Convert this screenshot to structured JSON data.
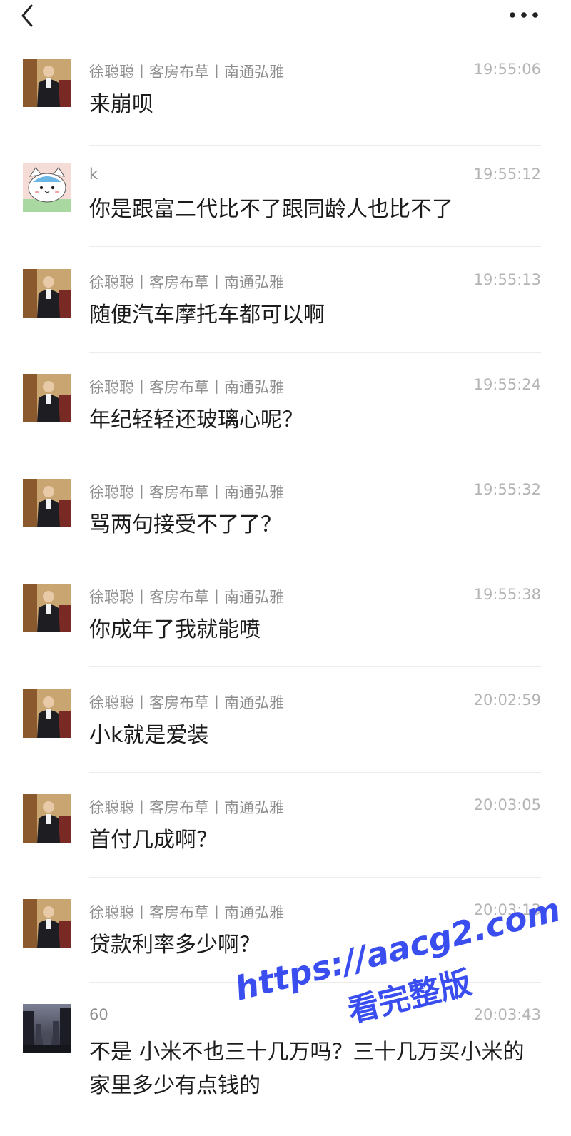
{
  "header": {
    "back_icon": "chevron-left-icon",
    "more_icon": "more-horizontal-icon"
  },
  "messages": [
    {
      "sender": "徐聪聪丨客房布草丨南通弘雅",
      "time": "19:55:06",
      "text": "来崩呗",
      "avatar": "man-in-suit-photo"
    },
    {
      "sender": "k",
      "time": "19:55:12",
      "text": "你是跟富二代比不了跟同龄人也比不了",
      "avatar": "cartoon-cat-avatar"
    },
    {
      "sender": "徐聪聪丨客房布草丨南通弘雅",
      "time": "19:55:13",
      "text": "随便汽车摩托车都可以啊",
      "avatar": "man-in-suit-photo"
    },
    {
      "sender": "徐聪聪丨客房布草丨南通弘雅",
      "time": "19:55:24",
      "text": "年纪轻轻还玻璃心呢？",
      "avatar": "man-in-suit-photo"
    },
    {
      "sender": "徐聪聪丨客房布草丨南通弘雅",
      "time": "19:55:32",
      "text": "骂两句接受不了了？",
      "avatar": "man-in-suit-photo"
    },
    {
      "sender": "徐聪聪丨客房布草丨南通弘雅",
      "time": "19:55:38",
      "text": "你成年了我就能喷",
      "avatar": "man-in-suit-photo"
    },
    {
      "sender": "徐聪聪丨客房布草丨南通弘雅",
      "time": "20:02:59",
      "text": "小k就是爱装",
      "avatar": "man-in-suit-photo"
    },
    {
      "sender": "徐聪聪丨客房布草丨南通弘雅",
      "time": "20:03:05",
      "text": "首付几成啊？",
      "avatar": "man-in-suit-photo"
    },
    {
      "sender": "徐聪聪丨客房布草丨南通弘雅",
      "time": "20:03:13",
      "text": "贷款利率多少啊？",
      "avatar": "man-in-suit-photo"
    },
    {
      "sender": "60",
      "time": "20:03:43",
      "text": "不是 小米不也三十几万吗？三十几万买小米的 家里多少有点钱的",
      "avatar": "city-street-photo"
    }
  ],
  "watermark": {
    "line1": "https://aacg2.com",
    "line2": "看完整版",
    "color": "#3a4ef0"
  }
}
